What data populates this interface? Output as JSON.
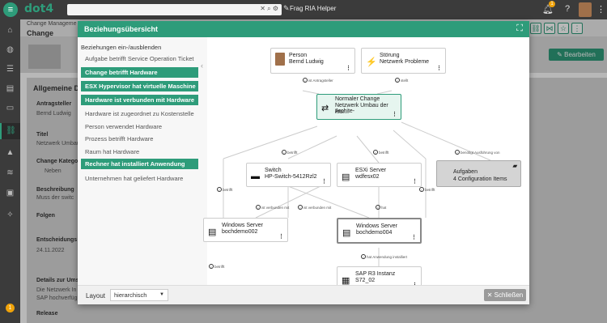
{
  "app": {
    "logo": "dot4",
    "helper": "Frag RIA Helper",
    "notif_count": "1",
    "sidebar_badge": "1"
  },
  "background": {
    "breadcrumb": "Change Manageme",
    "title": "Change",
    "panel_title": "Allgemeine D",
    "edit_label": "Bearbeiten",
    "fields": {
      "f1": "Antragsteller",
      "v1": "Bernd Ludwig",
      "f2": "Titel",
      "v2": "Netzwerk Umbau",
      "f3": "Change Kategorie",
      "v3": "Neben",
      "f4": "Beschreibung",
      "v4": "Muss der switc",
      "f5": "Folgen",
      "f6": "Entscheidungs",
      "v6": "24.11.2022",
      "f7": "Details zur Ums",
      "v7": "Die Netzwerk In",
      "v7b": "SAP hochverfüg",
      "f8": "Release"
    }
  },
  "modal": {
    "title": "Beziehungsübersicht",
    "toggle_header": "Beziehungen ein-/ausblenden",
    "relations": [
      {
        "label": "Aufgabe betrifft Service Operation Ticket",
        "active": false
      },
      {
        "label": "Change betrifft Hardware",
        "active": true
      },
      {
        "label": "ESX Hypervisor hat virtuelle Maschine",
        "active": true
      },
      {
        "label": "Hardware ist verbunden mit Hardware",
        "active": true
      },
      {
        "label": "Hardware ist zugeordnet zu Kostenstelle",
        "active": false
      },
      {
        "label": "Person verwendet Hardware",
        "active": false
      },
      {
        "label": "Prozess betrifft Hardware",
        "active": false
      },
      {
        "label": "Raum hat Hardware",
        "active": false
      },
      {
        "label": "Rechner hat installiert Anwendung",
        "active": true
      },
      {
        "label": "Unternehmen hat geliefert Hardware",
        "active": false
      }
    ],
    "layout_label": "Layout",
    "layout_value": "hierarchisch",
    "close_label": "Schließen"
  },
  "graph": {
    "nodes": {
      "person": {
        "l1": "Person",
        "l2": "Bernd Ludwig"
      },
      "stoerung": {
        "l1": "Störung",
        "l2": "Netzwerk Probleme"
      },
      "change": {
        "l1": "Normaler Change",
        "l2": "Netzwerk Umbau der Archite-",
        "l3": "ktur..."
      },
      "switch": {
        "l1": "Switch",
        "l2": "HP-Switch-5412Rzl2"
      },
      "esx": {
        "l1": "ESXi Server",
        "l2": "wdfesx02"
      },
      "aufgaben": {
        "l1": "Aufgaben",
        "l2": "4 Configuration Items"
      },
      "ws2": {
        "l1": "Windows Server",
        "l2": "bochdemo002"
      },
      "ws4": {
        "l1": "Windows Server",
        "l2": "bochdemo004"
      },
      "sap": {
        "l1": "SAP R3 Instanz",
        "l2": "S72_02"
      }
    },
    "edges": {
      "e1": "ist Antragsteller",
      "e2": "stellt",
      "e3": "betrifft",
      "e4": "betrifft",
      "e5": "benötigt Ausführung von",
      "e6": "betrifft",
      "e7": "ist verbunden mit",
      "e8": "ist verbunden mit",
      "e9": "hat",
      "e10": "betrifft",
      "e11": "betrifft",
      "e12": "hat Anwendung installiert"
    }
  }
}
